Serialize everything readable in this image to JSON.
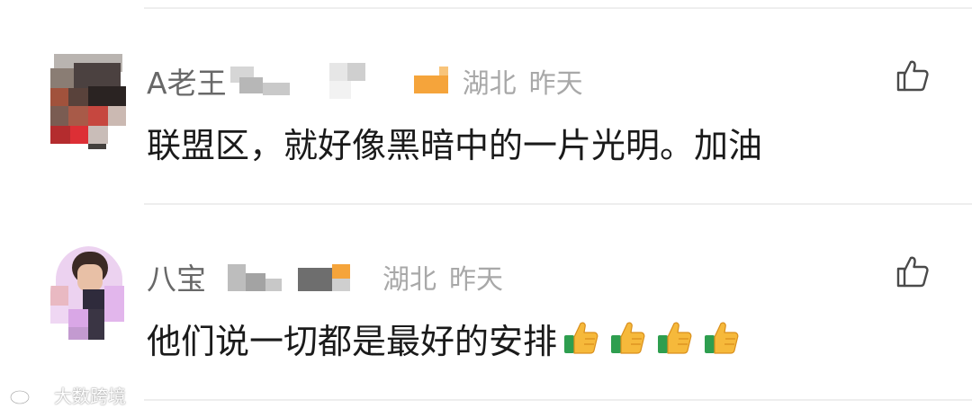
{
  "comments": [
    {
      "username": "A老王",
      "location": "湖北",
      "time": "昨天",
      "text": "联盟区，就好像黑暗中的一片光明。加油",
      "like_icon": "thumbs-up-outline-icon"
    },
    {
      "username": "八宝",
      "location": "湖北",
      "time": "昨天",
      "text": "他们说一切都是最好的安排",
      "emoji": "thumbs-up-emoji",
      "like_icon": "thumbs-up-outline-icon"
    }
  ],
  "watermark": {
    "text": "大数跨境",
    "icon": "weibo-logo-icon"
  },
  "colors": {
    "username": "#686868",
    "meta": "#a8a8a8",
    "content": "#1a1a1a",
    "divider": "#eeeeee",
    "badge_orange": "#f5a43b",
    "emoji_yellow": "#f6b93b",
    "emoji_green": "#2e9e4f"
  }
}
